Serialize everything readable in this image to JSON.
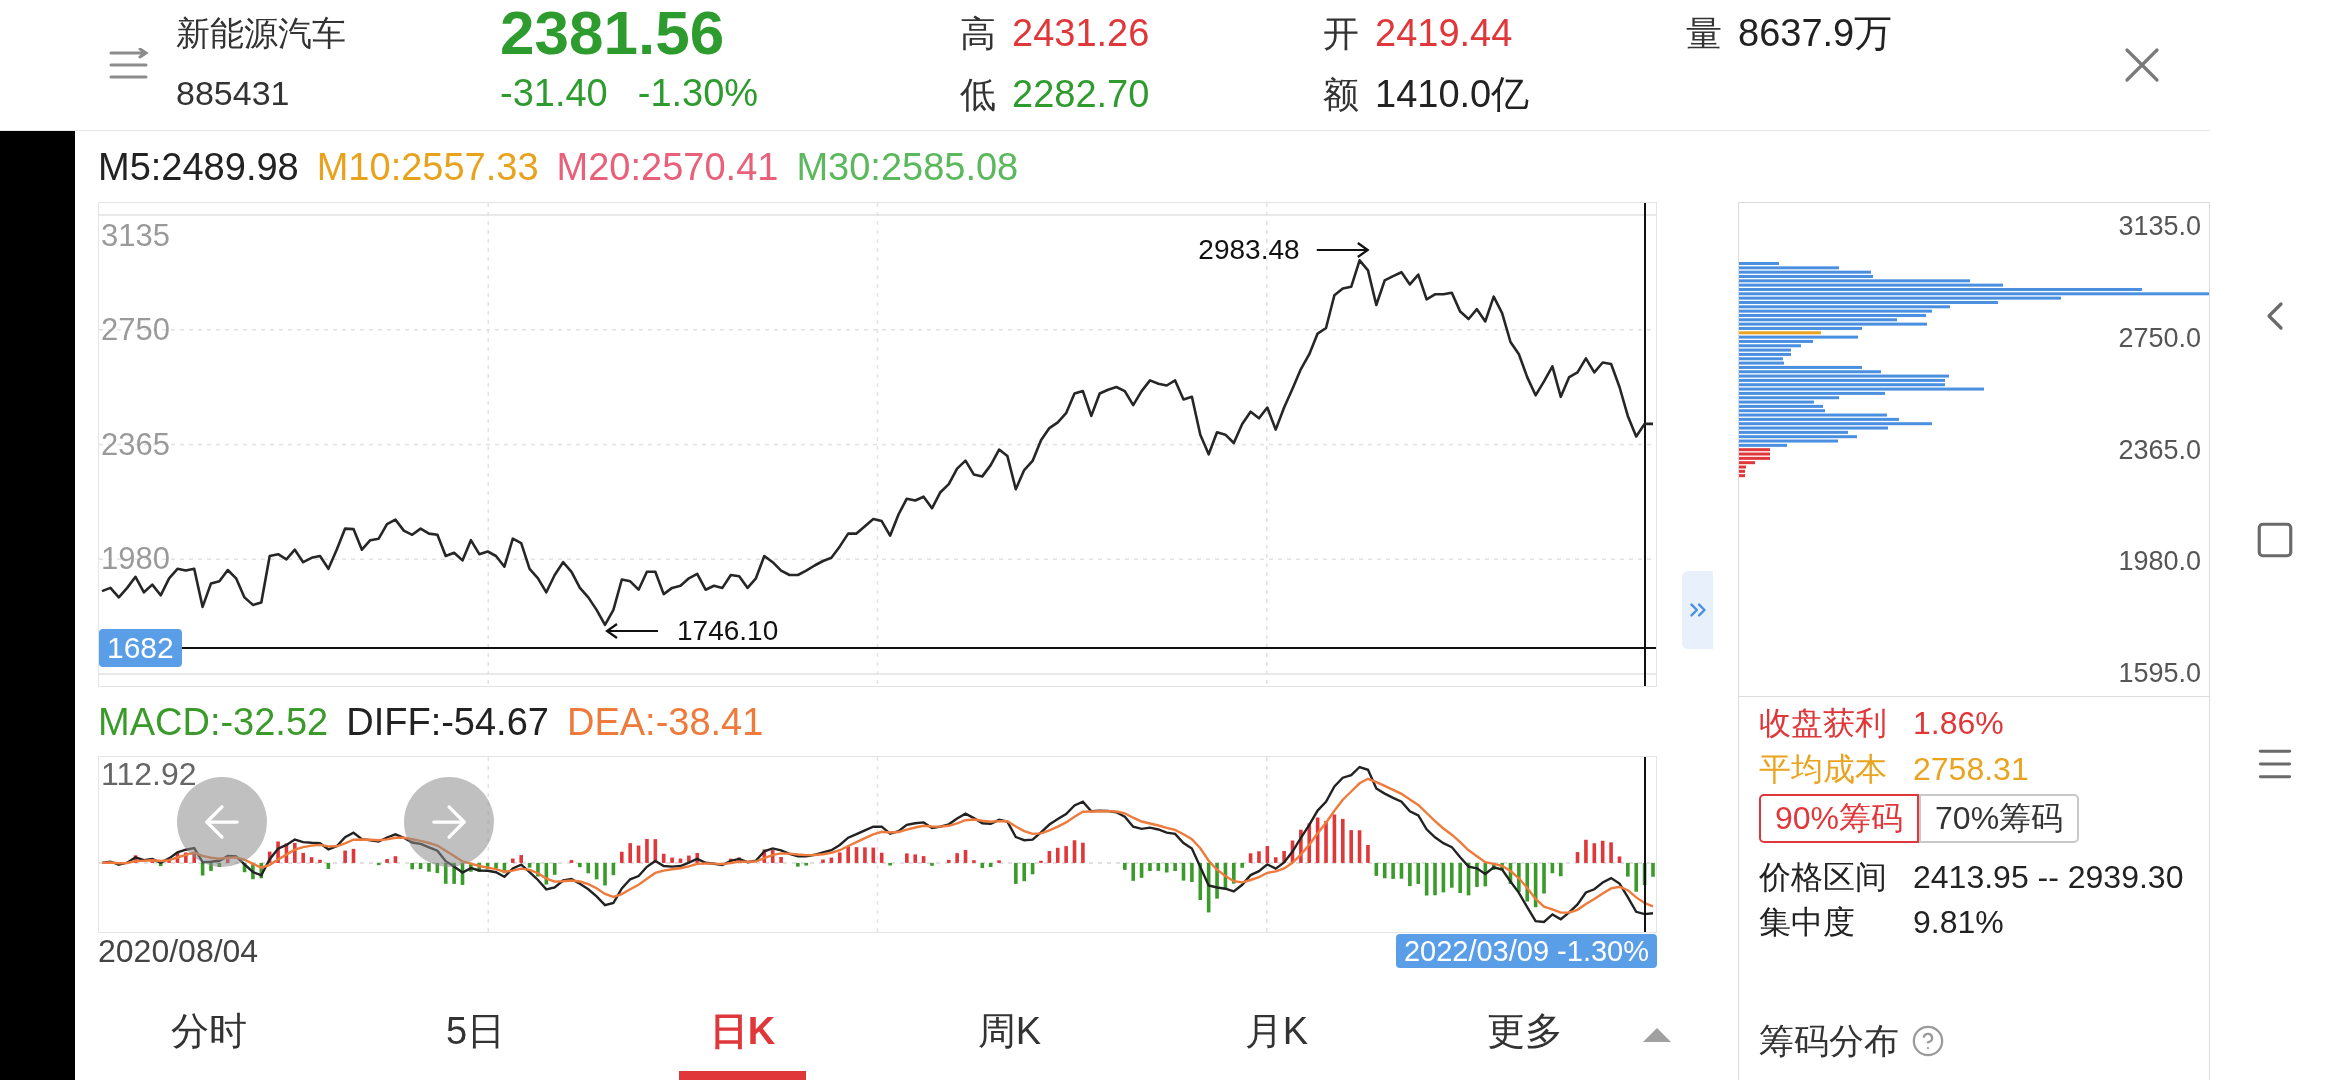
{
  "header": {
    "name": "新能源汽车",
    "code": "885431",
    "price": "2381.56",
    "change": "-31.40",
    "change_percent": "-1.30%",
    "rising": false,
    "stat_columns": [
      {
        "items": [
          {
            "label": "高",
            "value": "2431.26",
            "color": "#e0373a"
          },
          {
            "label": "低",
            "value": "2282.70",
            "color": "#2e9b2e"
          }
        ]
      },
      {
        "items": [
          {
            "label": "开",
            "value": "2419.44",
            "color": "#e0373a"
          },
          {
            "label": "额",
            "value": "1410.0亿",
            "color": "#222222"
          }
        ]
      },
      {
        "items": [
          {
            "label": "量",
            "value": "8637.9万",
            "color": "#222222"
          }
        ]
      }
    ]
  },
  "moving_averages": [
    {
      "label": "M5:2489.98",
      "color": "#222222"
    },
    {
      "label": "M10:2557.33",
      "color": "#e9a21c"
    },
    {
      "label": "M20:2570.41",
      "color": "#e8607a"
    },
    {
      "label": "M30:2585.08",
      "color": "#5cb85c"
    }
  ],
  "price_chart": {
    "chart_data": {
      "type": "line",
      "grid": true,
      "ylim": [
        1595,
        3135
      ],
      "yticks": [
        3135,
        2750,
        2365,
        1980
      ],
      "values": [
        1873,
        1884,
        1852,
        1884,
        1921,
        1869,
        1895,
        1859,
        1916,
        1948,
        1942,
        1948,
        1820,
        1899,
        1906,
        1944,
        1916,
        1852,
        1827,
        1835,
        1991,
        1997,
        1980,
        2012,
        1970,
        1985,
        1991,
        1948,
        2012,
        2083,
        2081,
        2012,
        2044,
        2049,
        2098,
        2113,
        2076,
        2062,
        2083,
        2066,
        2062,
        1991,
        2002,
        1976,
        2044,
        1997,
        2006,
        1991,
        1955,
        2049,
        2034,
        1948,
        1916,
        1869,
        1927,
        1970,
        1938,
        1884,
        1852,
        1810,
        1760,
        1810,
        1912,
        1906,
        1878,
        1938,
        1938,
        1863,
        1884,
        1891,
        1916,
        1931,
        1878,
        1891,
        1884,
        1927,
        1923,
        1884,
        1916,
        1991,
        1970,
        1942,
        1927,
        1927,
        1942,
        1959,
        1974,
        1985,
        2023,
        2066,
        2066,
        2091,
        2115,
        2108,
        2059,
        2130,
        2183,
        2177,
        2190,
        2151,
        2205,
        2232,
        2284,
        2311,
        2264,
        2258,
        2296,
        2348,
        2326,
        2215,
        2279,
        2310,
        2379,
        2420,
        2439,
        2470,
        2536,
        2544,
        2461,
        2536,
        2549,
        2558,
        2544,
        2497,
        2544,
        2580,
        2569,
        2563,
        2580,
        2516,
        2525,
        2398,
        2332,
        2406,
        2398,
        2370,
        2434,
        2475,
        2453,
        2489,
        2415,
        2489,
        2552,
        2618,
        2668,
        2737,
        2756,
        2866,
        2888,
        2894,
        2983,
        2949,
        2833,
        2916,
        2930,
        2943,
        2902,
        2935,
        2852,
        2869,
        2869,
        2874,
        2811,
        2786,
        2819,
        2778,
        2861,
        2806,
        2709,
        2668,
        2591,
        2530,
        2577,
        2627,
        2525,
        2591,
        2607,
        2654,
        2607,
        2640,
        2635,
        2558,
        2461,
        2392,
        2434,
        2434
      ],
      "annotations": [
        "2983.48",
        "1746.10"
      ],
      "ref_lines": [
        {
          "axis": "y",
          "value": 1682,
          "label": "1682"
        }
      ]
    }
  },
  "macd": {
    "readings": [
      {
        "label": "MACD:-32.52",
        "color": "#3a9a2a"
      },
      {
        "label": "DIFF:-54.67",
        "color": "#222222"
      },
      {
        "label": "DEA:-38.41",
        "color": "#ee7a3c"
      }
    ],
    "axis_label": "112.92",
    "start_date": "2020/08/04",
    "cursor_label": "2022/03/09 -1.30%"
  },
  "chip_distribution": {
    "price_labels": [
      "3135.0",
      "2750.0",
      "2365.0",
      "1980.0",
      "1595.0"
    ],
    "stats": [
      {
        "label": "收盘获利",
        "value": "1.86%",
        "color": "#e0373a"
      },
      {
        "label": "平均成本",
        "value": "2758.31",
        "color": "#eaa31e"
      }
    ],
    "ranges": [
      {
        "label": "90%筹码",
        "selected": true
      },
      {
        "label": "70%筹码",
        "selected": false
      }
    ],
    "details": [
      {
        "label": "价格区间",
        "value": "2413.95 -- 2939.30"
      },
      {
        "label": "集中度",
        "value": "9.81%"
      }
    ],
    "title": "筹码分布"
  },
  "tabs": [
    {
      "label": "分时",
      "selected": false
    },
    {
      "label": "5日",
      "selected": false
    },
    {
      "label": "日K",
      "selected": true
    },
    {
      "label": "周K",
      "selected": false
    },
    {
      "label": "月K",
      "selected": false
    },
    {
      "label": "更多",
      "selected": false
    }
  ]
}
